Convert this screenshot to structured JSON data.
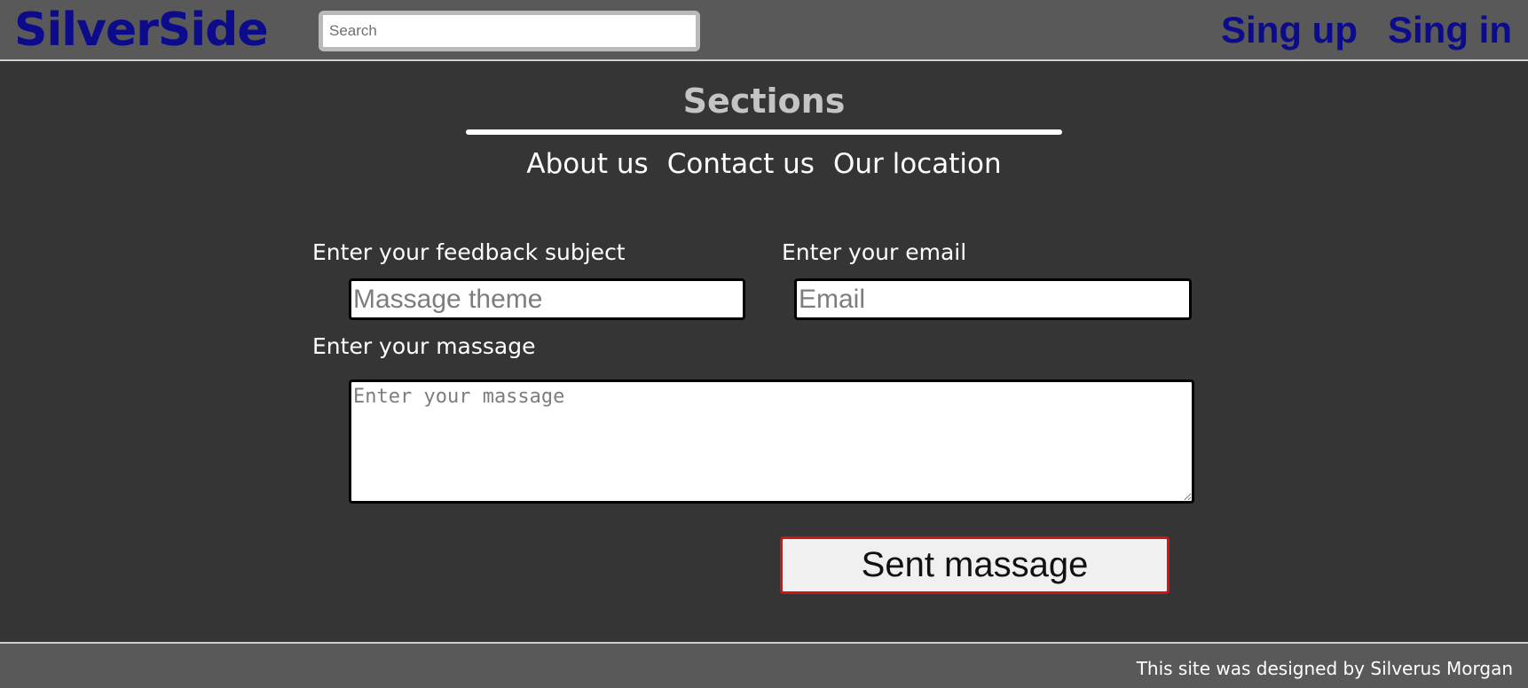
{
  "header": {
    "logo": "SilverSide",
    "search": {
      "placeholder": "Search",
      "value": ""
    },
    "auth": [
      {
        "label": "Sing up"
      },
      {
        "label": "Sing in"
      }
    ]
  },
  "sections": {
    "title": "Sections",
    "nav": [
      {
        "label": "About us"
      },
      {
        "label": "Contact us"
      },
      {
        "label": "Our location"
      }
    ]
  },
  "form": {
    "subject": {
      "label": "Enter your feedback subject",
      "placeholder": "Massage theme",
      "value": ""
    },
    "email": {
      "label": "Enter your email",
      "placeholder": "Email",
      "value": ""
    },
    "message": {
      "label": "Enter your massage",
      "placeholder": "Enter your massage",
      "value": ""
    },
    "submit_label": "Sent massage"
  },
  "footer": {
    "text": "This site was designed by Silverus Morgan"
  },
  "colors": {
    "brand_link": "#0b0b8c",
    "header_bg": "#595959",
    "page_bg": "#353535",
    "submit_border": "#d11414"
  }
}
